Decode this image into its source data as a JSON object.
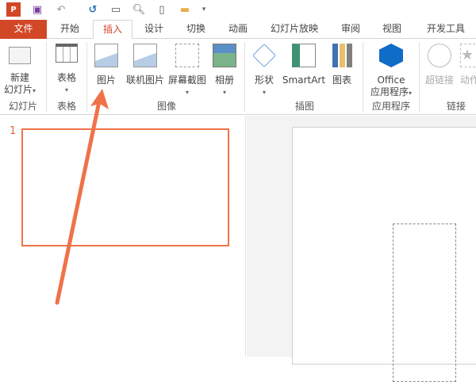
{
  "quick_access": {
    "icons": [
      "powerpoint-logo-icon",
      "save-icon",
      "undo-icon",
      "redo-icon",
      "present-from-start-icon",
      "print-preview-icon",
      "new-file-icon",
      "open-folder-icon",
      "customize-icon"
    ]
  },
  "tabs": [
    "文件",
    "开始",
    "插入",
    "设计",
    "切换",
    "动画",
    "幻灯片放映",
    "审阅",
    "视图",
    "开发工具"
  ],
  "active_tab": "插入",
  "ribbon": {
    "buttons": {
      "new_slide": "新建",
      "new_slide2": "幻灯片",
      "table": "表格",
      "picture": "图片",
      "online_picture": "联机图片",
      "screenshot": "屏幕截图",
      "album": "相册",
      "shapes": "形状",
      "smartart": "SmartArt",
      "chart": "图表",
      "office1": "Office",
      "office2": "应用程序",
      "hyperlink": "超链接",
      "action": "动作"
    },
    "groups": {
      "slides": "幻灯片",
      "tables": "表格",
      "images": "图像",
      "illustrations": "插图",
      "apps": "应用程序",
      "links": "链接"
    }
  },
  "slides_pane": {
    "slide_number": "1"
  },
  "colors": {
    "accent": "#d24726",
    "annotation": "#f07249"
  }
}
